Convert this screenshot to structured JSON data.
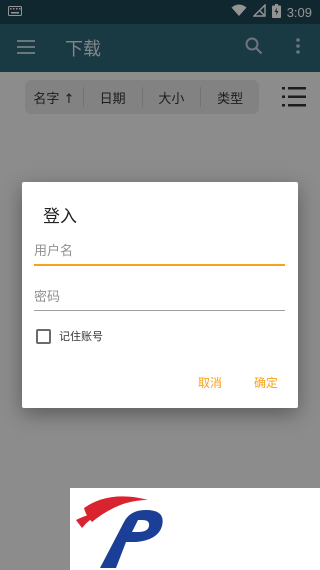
{
  "status_bar": {
    "time": "3:09"
  },
  "app_bar": {
    "title": "下载"
  },
  "sort_bar": {
    "items": [
      {
        "label": "名字 ↑"
      },
      {
        "label": "日期"
      },
      {
        "label": "大小"
      },
      {
        "label": "类型"
      }
    ]
  },
  "dialog": {
    "title": "登入",
    "username_placeholder": "用户名",
    "password_placeholder": "密码",
    "remember_label": "记住账号",
    "cancel_label": "取消",
    "confirm_label": "确定"
  },
  "icons": {
    "status_left": "keyboard-icon",
    "wifi": "wifi-icon",
    "signal": "no-signal-icon",
    "battery": "battery-charging-icon",
    "menu": "menu-icon",
    "search": "search-icon",
    "more": "more-vert-icon",
    "list_view": "list-view-icon"
  },
  "colors": {
    "status_bar": "#1d4452",
    "app_bar": "#2b6274",
    "accent": "#f6a21e",
    "logo_red": "#d9232e",
    "logo_blue": "#1b3e97"
  }
}
